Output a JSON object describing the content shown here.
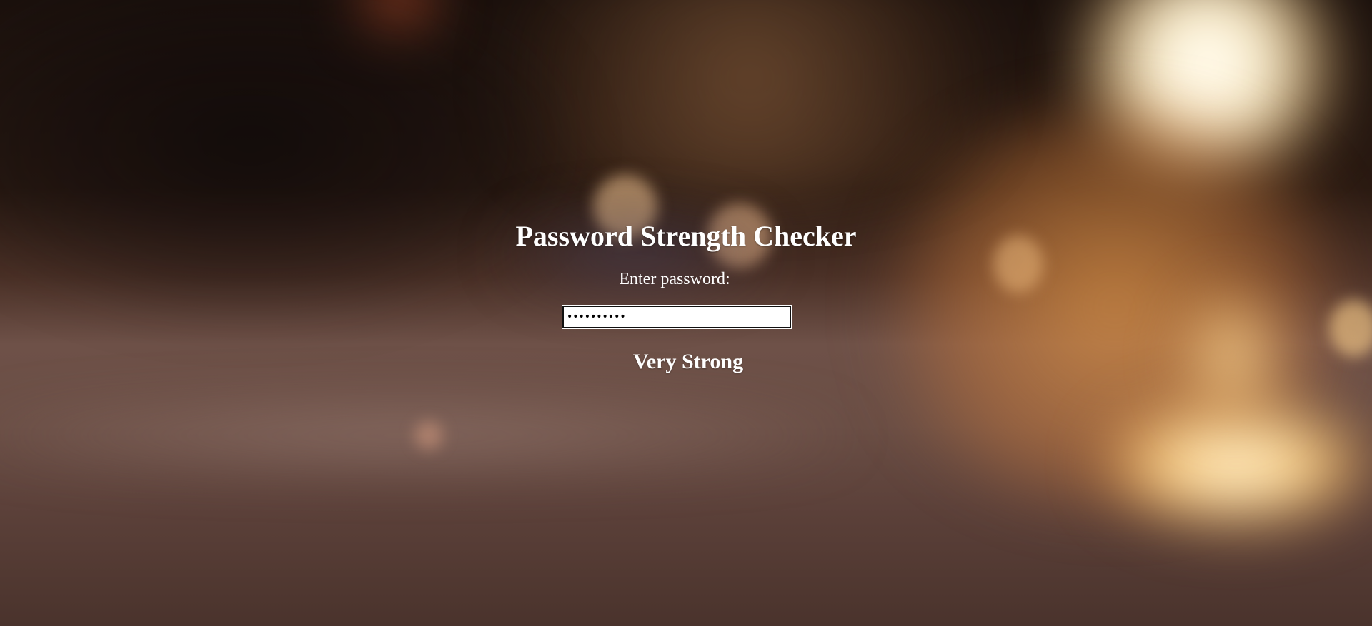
{
  "app": {
    "title": "Password Strength Checker"
  },
  "form": {
    "label": "Enter password:",
    "password_value": "••••••••••"
  },
  "result": {
    "strength_text": "Very Strong"
  },
  "colors": {
    "text": "#ffffff",
    "input_bg": "#ffffff",
    "input_border": "#111111"
  }
}
